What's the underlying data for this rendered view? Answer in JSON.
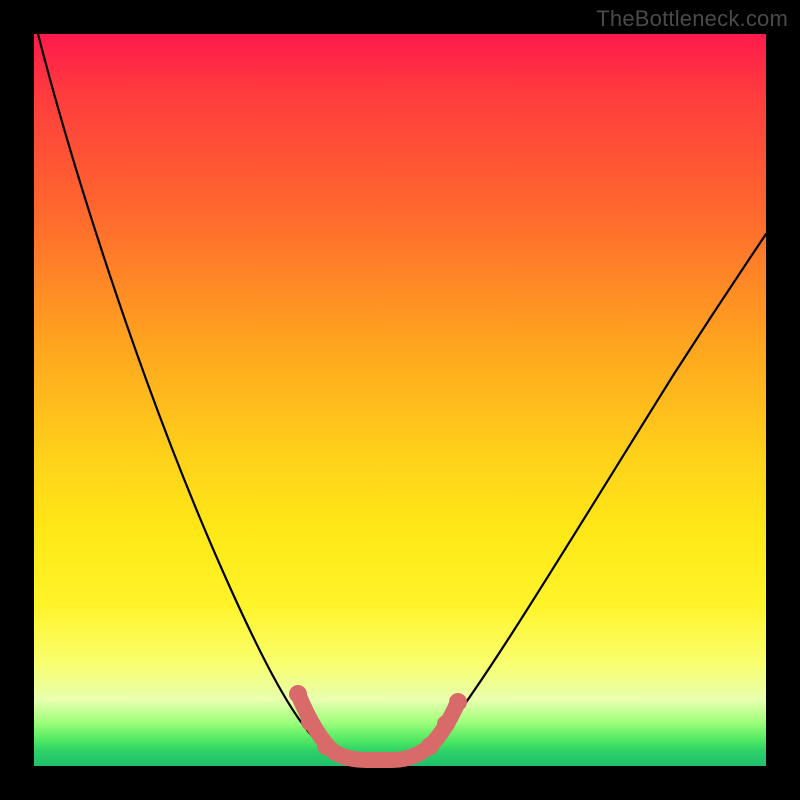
{
  "watermark": {
    "text": "TheBottleneck.com"
  },
  "chart_data": {
    "type": "line",
    "title": "",
    "xlabel": "",
    "ylabel": "",
    "xlim": [
      0,
      100
    ],
    "ylim": [
      0,
      100
    ],
    "series": [
      {
        "name": "bottleneck-curve",
        "x": [
          0,
          5,
          10,
          15,
          20,
          25,
          30,
          35,
          38,
          40,
          42,
          44,
          46,
          48,
          50,
          55,
          60,
          65,
          70,
          75,
          80,
          85,
          90,
          95,
          100
        ],
        "values": [
          100,
          90,
          79,
          68,
          56,
          45,
          33,
          20,
          10,
          4,
          1,
          0,
          0,
          0,
          1,
          5,
          12,
          20,
          28,
          36,
          44,
          52,
          59,
          64,
          68
        ]
      }
    ],
    "highlight": {
      "name": "optimal-range",
      "x": [
        35,
        37,
        39,
        41,
        43,
        45,
        47,
        49,
        51
      ],
      "values": [
        12,
        7,
        3,
        1,
        0,
        0,
        1,
        3,
        8
      ]
    },
    "gradient_stops": [
      {
        "pos": 0,
        "color": "#ff1a4d"
      },
      {
        "pos": 50,
        "color": "#ffd21a"
      },
      {
        "pos": 90,
        "color": "#f9ff6e"
      },
      {
        "pos": 100,
        "color": "#1fc06a"
      }
    ]
  }
}
